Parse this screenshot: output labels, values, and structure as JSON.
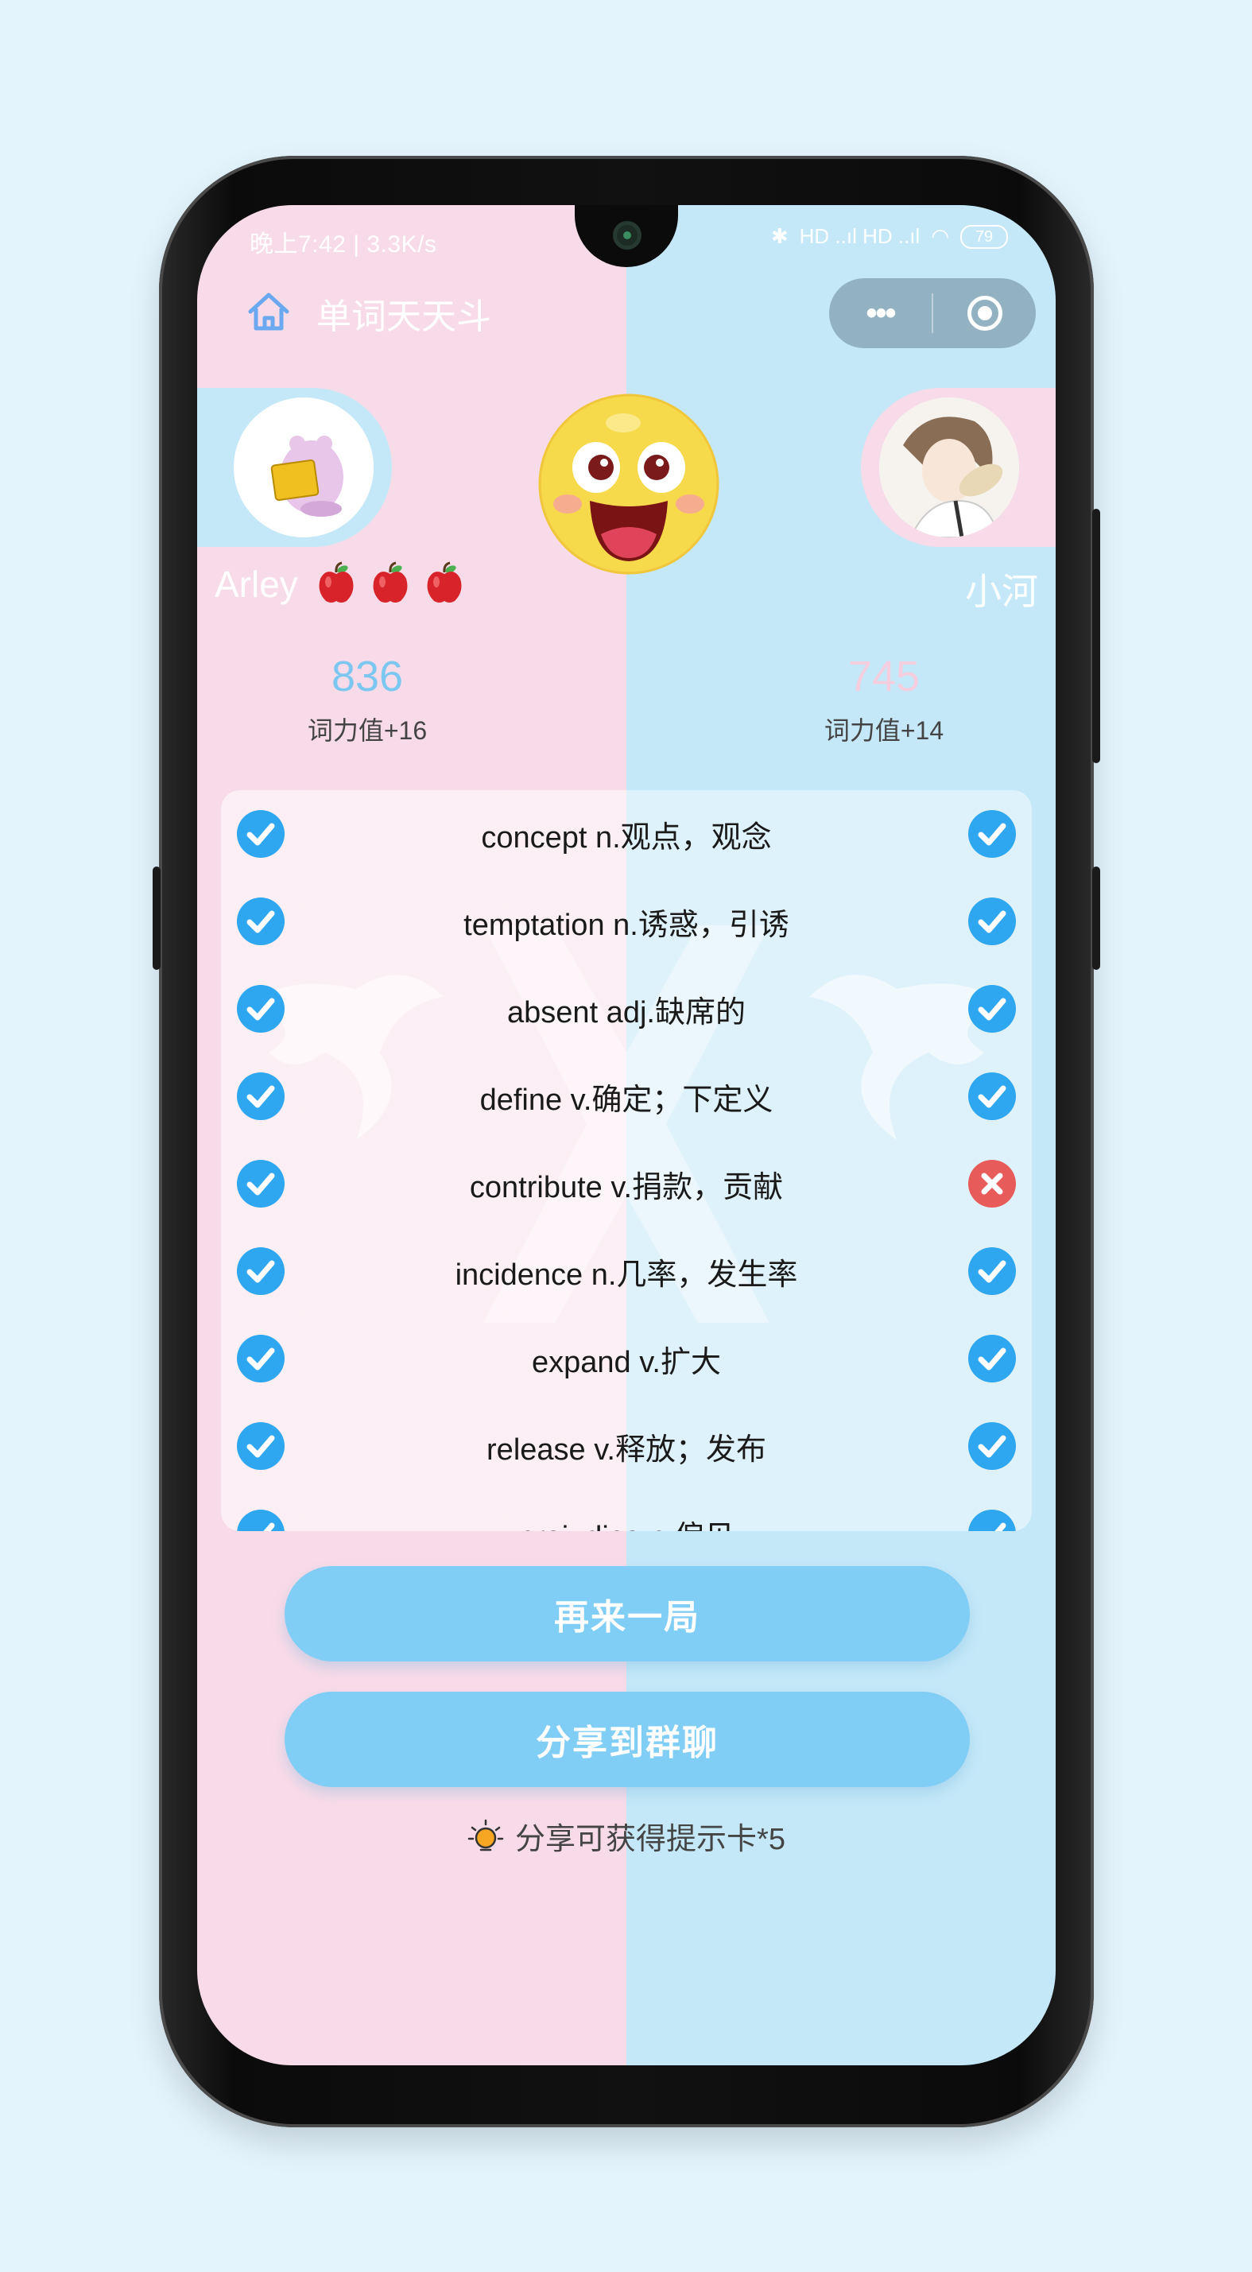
{
  "status_bar": {
    "time_speed": "晚上7:42 | 3.3K/s",
    "signal": "HD ..ıl HD ..ıl",
    "battery": "79"
  },
  "nav": {
    "title": "单词天天斗",
    "menu_dots": "•••"
  },
  "players": {
    "left": {
      "name": "Arley",
      "score": "836",
      "gain": "词力值+16",
      "apples": 3
    },
    "right": {
      "name": "小河",
      "score": "745",
      "gain": "词力值+14"
    }
  },
  "words": [
    {
      "text": "concept n.观点，观念",
      "left": "correct",
      "right": "correct"
    },
    {
      "text": "temptation n.诱惑，引诱",
      "left": "correct",
      "right": "correct"
    },
    {
      "text": "absent adj.缺席的",
      "left": "correct",
      "right": "correct"
    },
    {
      "text": "define v.确定；下定义",
      "left": "correct",
      "right": "correct"
    },
    {
      "text": "contribute v.捐款，贡献",
      "left": "correct",
      "right": "wrong"
    },
    {
      "text": "incidence n.几率，发生率",
      "left": "correct",
      "right": "correct"
    },
    {
      "text": "expand v.扩大",
      "left": "correct",
      "right": "correct"
    },
    {
      "text": "release v.释放；发布",
      "left": "correct",
      "right": "correct"
    },
    {
      "text": "prejudice n.偏见",
      "left": "correct",
      "right": "correct"
    }
  ],
  "actions": {
    "again": "再来一局",
    "share": "分享到群聊",
    "tip": "分享可获得提示卡*5"
  },
  "colors": {
    "correct": "#2ea7f0",
    "wrong": "#e85b5b",
    "button": "#80cdf5",
    "pink_side": "#f8dbe8",
    "blue_side": "#c4e8f8"
  }
}
